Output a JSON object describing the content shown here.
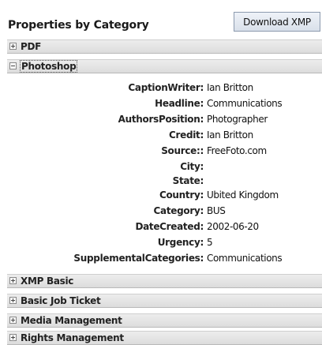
{
  "header": {
    "title": "Properties by Category",
    "download_label": "Download XMP"
  },
  "sections_top": [
    {
      "label": "PDF",
      "expanded": false,
      "toggle": "plus-icon"
    },
    {
      "label": "Photoshop",
      "expanded": true,
      "toggle": "minus-icon"
    }
  ],
  "photoshop": {
    "rows": [
      {
        "key": "CaptionWriter:",
        "value": "Ian Britton"
      },
      {
        "key": "Headline:",
        "value": "Communications"
      },
      {
        "key": "AuthorsPosition:",
        "value": "Photographer"
      },
      {
        "key": "Credit:",
        "value": "Ian Britton"
      },
      {
        "key": "Source::",
        "value": "FreeFoto.com"
      },
      {
        "key": "City:",
        "value": ""
      },
      {
        "key": "State:",
        "value": ""
      },
      {
        "key": "Country:",
        "value": "Ubited Kingdom"
      },
      {
        "key": "Category:",
        "value": "BUS"
      },
      {
        "key": "DateCreated:",
        "value": "2002-06-20"
      },
      {
        "key": "Urgency:",
        "value": "5"
      },
      {
        "key": "SupplementalCategories:",
        "value": "Communications"
      }
    ]
  },
  "sections_bottom": [
    {
      "label": "XMP Basic",
      "expanded": false,
      "toggle": "plus-icon"
    },
    {
      "label": "Basic Job Ticket",
      "expanded": false,
      "toggle": "plus-icon"
    },
    {
      "label": "Media Management",
      "expanded": false,
      "toggle": "plus-icon"
    },
    {
      "label": "Rights Management",
      "expanded": false,
      "toggle": "plus-icon"
    }
  ]
}
